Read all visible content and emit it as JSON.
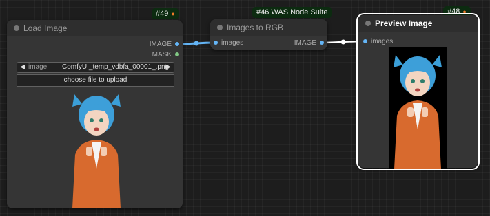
{
  "nodes": {
    "load_image": {
      "badge": "#49",
      "title": "Load Image",
      "outputs": [
        "IMAGE",
        "MASK"
      ],
      "image_widget": {
        "name": "image",
        "value": "ComfyUI_temp_vdbfa_00001_.png"
      },
      "upload_label": "choose file to upload"
    },
    "images_to_rgb": {
      "badge": "#46 WAS Node Suite",
      "title": "Images to RGB",
      "input": "images",
      "output": "IMAGE"
    },
    "preview_image": {
      "badge": "#48",
      "title": "Preview Image",
      "input": "images"
    }
  },
  "icons": {
    "badge_icon": "fox-icon",
    "arrow_left": "◀",
    "arrow_right": "▶"
  },
  "colors": {
    "image_link": "#64b5f6",
    "mask_link": "#81c784",
    "selected_outline": "#ffffff",
    "badge_bg": "#0c2b10"
  }
}
